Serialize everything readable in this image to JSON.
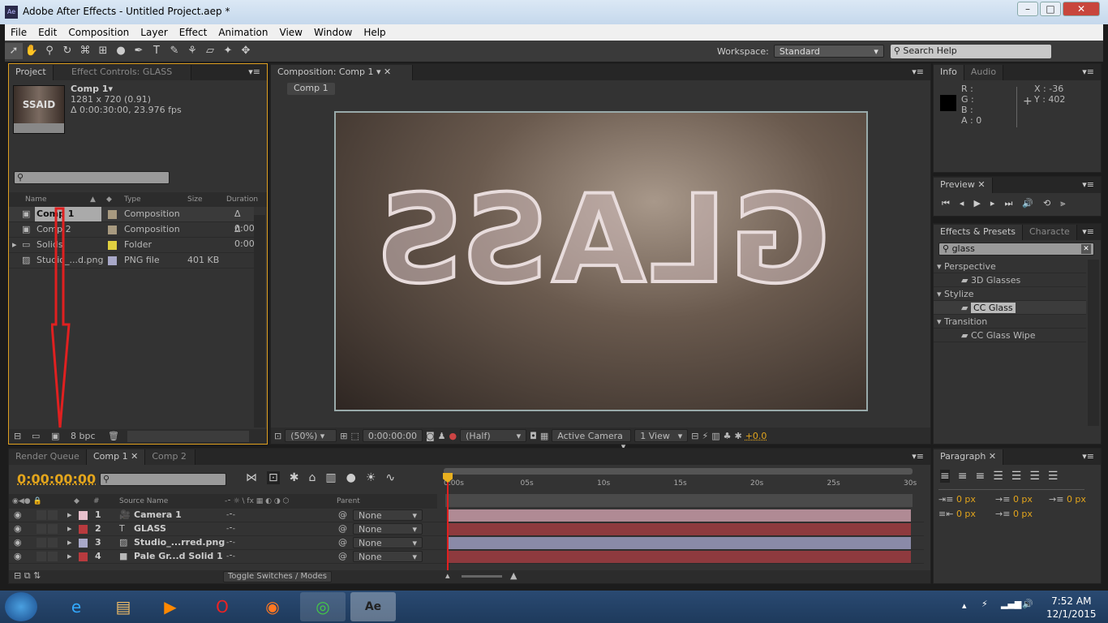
{
  "window": {
    "title": "Adobe After Effects - Untitled Project.aep *",
    "app_icon": "Ae"
  },
  "menu": [
    "File",
    "Edit",
    "Composition",
    "Layer",
    "Effect",
    "Animation",
    "View",
    "Window",
    "Help"
  ],
  "toolbar": {
    "workspace_label": "Workspace:",
    "workspace_value": "Standard",
    "search_placeholder": "Search Help"
  },
  "project": {
    "tabs": [
      "Project",
      "Effect Controls: GLASS"
    ],
    "comp_name": "Comp 1▾",
    "comp_dims": "1281 x 720 (0.91)",
    "comp_duration": "Δ 0:00:30:00, 23.976 fps",
    "thumb_text": "SSAID",
    "columns": [
      "Name",
      "Type",
      "Size",
      "Duration"
    ],
    "items": [
      {
        "name": "Comp 1",
        "type": "Composition",
        "size": "",
        "duration": "Δ 0:00",
        "color": "#a89a80"
      },
      {
        "name": "Comp 2",
        "type": "Composition",
        "size": "",
        "duration": "Δ 0:00",
        "color": "#a89a80"
      },
      {
        "name": "Solids",
        "type": "Folder",
        "size": "",
        "duration": "",
        "color": "#e0d040"
      },
      {
        "name": "Studio_...d.png",
        "type": "PNG file",
        "size": "401 KB",
        "duration": "",
        "color": "#a8a8c8"
      }
    ],
    "bpc": "8 bpc"
  },
  "composition": {
    "tab": "Composition: Comp 1",
    "nav": "Comp 1",
    "viewer_text": "GLASS",
    "zoom": "(50%)",
    "timecode": "0:00:00:00",
    "resolution": "(Half)",
    "camera": "Active Camera",
    "views": "1 View",
    "exposure": "+0.0"
  },
  "info": {
    "tabs": [
      "Info",
      "Audio"
    ],
    "r": "R :",
    "g": "G :",
    "b": "B :",
    "a": "A : 0",
    "x": "X : -36",
    "y": "Y : 402"
  },
  "preview": {
    "tab": "Preview"
  },
  "effects": {
    "tabs": [
      "Effects & Presets",
      "Characte"
    ],
    "search": "glass",
    "groups": [
      {
        "name": "Perspective",
        "items": [
          "3D Glasses"
        ]
      },
      {
        "name": "Stylize",
        "items": [
          "CC Glass"
        ]
      },
      {
        "name": "Transition",
        "items": [
          "CC Glass Wipe"
        ]
      }
    ]
  },
  "timeline": {
    "tabs": [
      "Render Queue",
      "Comp 1",
      "Comp 2"
    ],
    "timecode": "0:00:00:00",
    "col_num": "#",
    "col_source": "Source Name",
    "col_parent": "Parent",
    "ticks": [
      "0:00s",
      "05s",
      "10s",
      "15s",
      "20s",
      "25s",
      "30s"
    ],
    "layers": [
      {
        "num": "1",
        "name": "Camera 1",
        "color": "#e8c0cc",
        "bar": "#b08a94",
        "parent": "None",
        "icon": "camera-icon"
      },
      {
        "num": "2",
        "name": "GLASS",
        "color": "#b83a3e",
        "bar": "#8e3a3e",
        "parent": "None",
        "icon": "text-layer-icon"
      },
      {
        "num": "3",
        "name": "Studio_...rred.png",
        "color": "#a8a8c8",
        "bar": "#8a8aa8",
        "parent": "None",
        "icon": "image-icon"
      },
      {
        "num": "4",
        "name": "Pale Gr...d Solid 1",
        "color": "#b83a3e",
        "bar": "#8e3a3e",
        "parent": "None",
        "icon": "solid-icon"
      }
    ],
    "toggle": "Toggle Switches / Modes"
  },
  "paragraph": {
    "tab": "Paragraph",
    "values": [
      "0 px",
      "0 px",
      "0 px",
      "0 px",
      "0 px"
    ]
  },
  "taskbar": {
    "time": "7:52 AM",
    "date": "12/1/2015",
    "apps": [
      "ie-icon",
      "explorer-icon",
      "media-player-icon",
      "opera-icon",
      "firefox-icon",
      "chrome-icon",
      "after-effects-icon"
    ]
  }
}
